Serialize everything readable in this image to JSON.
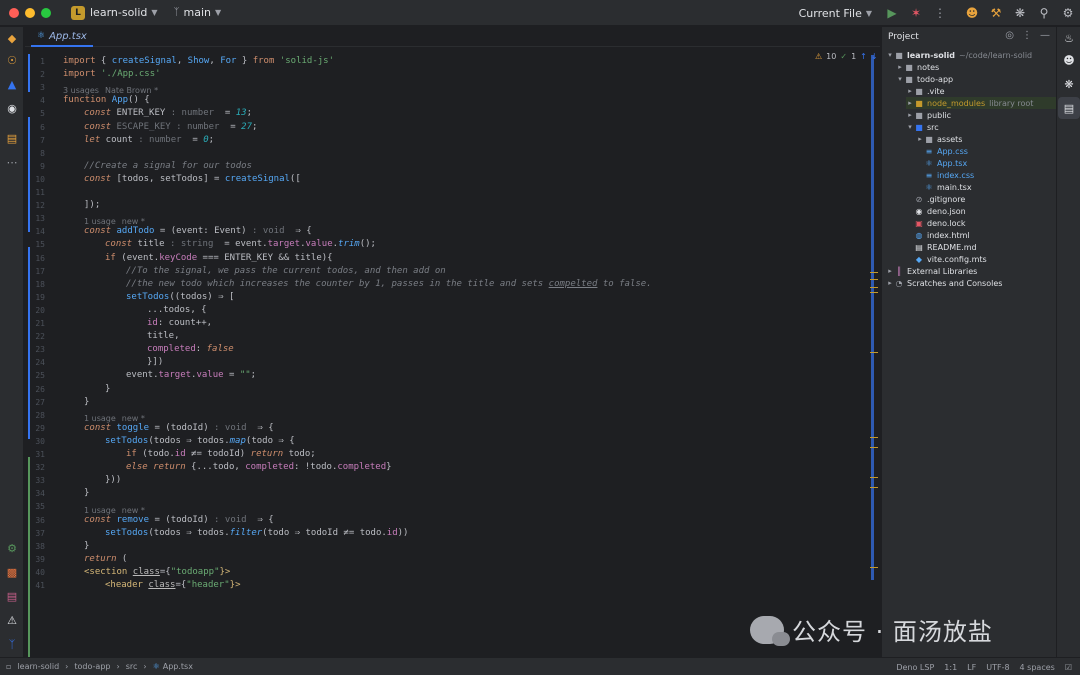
{
  "titlebar": {
    "project_initial": "L",
    "project_name": "learn-solid",
    "branch": "main",
    "run_config": "Current File",
    "traffic_colors": [
      "#ff5f57",
      "#febc2e",
      "#28c840"
    ]
  },
  "editor": {
    "tab_label": "App.tsx",
    "inspection_warnings": "10",
    "inspection_typos": "1",
    "lines": [
      {
        "n": "1"
      },
      {
        "n": "2"
      },
      {
        "n": "3"
      },
      {
        "n": "4"
      },
      {
        "n": "5"
      },
      {
        "n": "6"
      },
      {
        "n": "7"
      },
      {
        "n": "8"
      },
      {
        "n": "9"
      },
      {
        "n": "10"
      },
      {
        "n": "11"
      },
      {
        "n": "12"
      },
      {
        "n": "13"
      },
      {
        "n": "14"
      },
      {
        "n": "15"
      },
      {
        "n": "16"
      },
      {
        "n": "17"
      },
      {
        "n": "18"
      },
      {
        "n": "19"
      },
      {
        "n": "20"
      },
      {
        "n": "21"
      },
      {
        "n": "22"
      },
      {
        "n": "23"
      },
      {
        "n": "24"
      },
      {
        "n": "25"
      },
      {
        "n": "26"
      },
      {
        "n": "27"
      },
      {
        "n": "28"
      },
      {
        "n": "29"
      },
      {
        "n": "30"
      },
      {
        "n": "31"
      },
      {
        "n": "32"
      },
      {
        "n": "33"
      },
      {
        "n": "34"
      },
      {
        "n": "35"
      },
      {
        "n": "36"
      },
      {
        "n": "37"
      },
      {
        "n": "38"
      },
      {
        "n": "39"
      },
      {
        "n": "40"
      },
      {
        "n": "41"
      }
    ],
    "hints": {
      "usages_app": "3 usages",
      "author_app": "Nate Brown *",
      "usage_add": "1 usage",
      "new_add": "new *",
      "usage_toggle": "1 usage",
      "new_toggle": "new *",
      "usage_remove": "1 usage",
      "new_remove": "new *"
    },
    "code": {
      "l1_import": "import",
      "l1_open": " { ",
      "l1_create": "createSignal",
      "l1_c1": ", ",
      "l1_show": "Show",
      "l1_c2": ", ",
      "l1_for": "For",
      "l1_close": " } ",
      "l1_from": "from",
      "l1_sp": " ",
      "l1_mod": "'solid-js'",
      "l2_import": "import",
      "l2_sp": " ",
      "l2_mod": "'./App.css'",
      "l4_function": "function",
      "l4_sp": " ",
      "l4_name": "App",
      "l4_rest": "() {",
      "l5_const": "const",
      "l5_name": " ENTER_KEY",
      "l5_type": " : number ",
      "l5_eq": " = ",
      "l5_val": "13",
      "l5_semi": ";",
      "l6_const": "const",
      "l6_name": " ESCAPE_KEY",
      "l6_type": " : number ",
      "l6_eq": " = ",
      "l6_val": "27",
      "l6_semi": ";",
      "l7_let": "let",
      "l7_name": " count",
      "l7_type": " : number ",
      "l7_eq": " = ",
      "l7_val": "0",
      "l7_semi": ";",
      "l9_comment": "//Create a signal for our todos",
      "l10_const": "const",
      "l10_rest": " [todos, setTodos] = ",
      "l10_fn": "createSignal",
      "l10_end": "([",
      "l12_end": "]);",
      "l14_const": "const",
      "l14_name": " addTodo",
      "l14_eq": " = (",
      "l14_param": "event",
      "l14_colon": ": Event)",
      "l14_type": " : void ",
      "l14_arrow": " ⇒ {",
      "l15_const": "const",
      "l15_name": " title",
      "l15_type": " : string ",
      "l15_eq": " = ",
      "l15_event": "event",
      "l15_dot1": ".",
      "l15_target": "target",
      "l15_dot2": ".",
      "l15_value": "value",
      "l15_dot3": ".",
      "l15_trim": "trim",
      "l15_end": "();",
      "l16_if": "if",
      "l16_open": " (",
      "l16_event": "event",
      "l16_dot": ".",
      "l16_key": "keyCode",
      "l16_rest": " === ENTER_KEY && title){",
      "l17_comment": "//To the signal, we pass the current todos, and then add on",
      "l18_comment_a": "//the new ",
      "l18_comment_b": "todo which increases the counter by 1, passes in the title and sets ",
      "l18_comment_c": "compelted",
      "l18_comment_d": " to false.",
      "l19_fn": "setTodos",
      "l19_rest": "((todos) ⇒ [",
      "l20_text": "...todos, {",
      "l21_id": "id",
      "l21_rest": ": count++,",
      "l22_text": "title,",
      "l23_key": "completed",
      "l23_colon": ": ",
      "l23_val": "false",
      "l24_text": "}])",
      "l25_event": "event",
      "l25_dot1": ".",
      "l25_target": "target",
      "l25_dot2": ".",
      "l25_value": "value",
      "l25_rest": " = ",
      "l25_str": "\"\"",
      "l25_semi": ";",
      "l26_text": "}",
      "l27_text": "}",
      "l29_const": "const",
      "l29_name": " toggle",
      "l29_eq": " = (todoId)",
      "l29_type": " : void ",
      "l29_arrow": " ⇒ {",
      "l30_fn": "setTodos",
      "l30_a": "(todos ⇒ todos.",
      "l30_map": "map",
      "l30_b": "(todo ⇒ {",
      "l31_if": "if",
      "l31_a": " (todo.",
      "l31_id": "id",
      "l31_b": " ≠= todoId) ",
      "l31_return": "return",
      "l31_c": " todo;",
      "l32_else": "else",
      "l32_sp": " ",
      "l32_return": "return",
      "l32_a": " {...todo, ",
      "l32_completed": "completed",
      "l32_b": ": !todo.",
      "l32_completed2": "completed",
      "l32_c": "}",
      "l33_text": "}))",
      "l34_text": "}",
      "l36_const": "const",
      "l36_name": " remove",
      "l36_eq": " = (todoId)",
      "l36_type": " : void ",
      "l36_arrow": " ⇒ {",
      "l37_fn": "setTodos",
      "l37_a": "(todos ⇒ todos.",
      "l37_filter": "filter",
      "l37_b": "(todo ⇒ todoId ≠= todo.",
      "l37_id": "id",
      "l37_c": "))",
      "l38_text": "}",
      "l39_return": "return",
      "l39_rest": " (",
      "l40_open": "<section ",
      "l40_attr": "class",
      "l40_eq": "={",
      "l40_str": "\"todoapp\"",
      "l40_close": "}>",
      "l41_open": "<header ",
      "l41_attr": "class",
      "l41_eq": "={",
      "l41_str": "\"header\"",
      "l41_close": "}>"
    }
  },
  "project": {
    "title": "Project",
    "root_name": "learn-solid",
    "root_path": "~/code/learn-solid",
    "items": [
      {
        "label": "notes"
      },
      {
        "label": "todo-app"
      },
      {
        "label": ".vite"
      },
      {
        "label": "node_modules",
        "sub": "library root"
      },
      {
        "label": "public"
      },
      {
        "label": "src"
      },
      {
        "label": "assets"
      },
      {
        "label": "App.css"
      },
      {
        "label": "App.tsx"
      },
      {
        "label": "index.css"
      },
      {
        "label": "main.tsx"
      },
      {
        "label": ".gitignore"
      },
      {
        "label": "deno.json"
      },
      {
        "label": "deno.lock"
      },
      {
        "label": "index.html"
      },
      {
        "label": "README.md"
      },
      {
        "label": "vite.config.mts"
      },
      {
        "label": "External Libraries"
      },
      {
        "label": "Scratches and Consoles"
      }
    ]
  },
  "statusbar": {
    "crumbs": [
      "learn-solid",
      "todo-app",
      "src",
      "App.tsx"
    ],
    "lsp": "Deno LSP",
    "position": "1:1",
    "line_sep": "LF",
    "encoding": "UTF-8",
    "indent": "4 spaces"
  },
  "watermark": {
    "text": "公众号 · 面汤放盐"
  }
}
